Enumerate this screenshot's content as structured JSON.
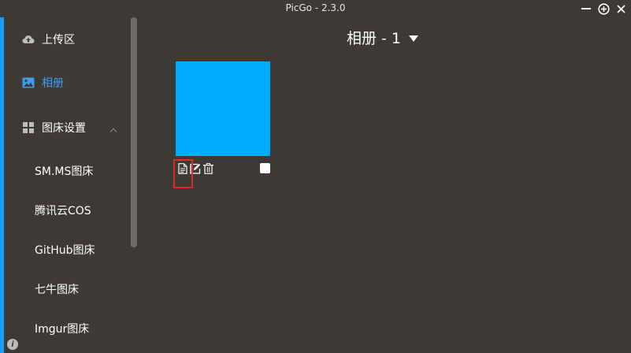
{
  "window": {
    "title": "PicGo - 2.3.0"
  },
  "sidebar": {
    "items": [
      {
        "label": "上传区",
        "icon": "cloud-upload-icon",
        "active": false
      },
      {
        "label": "相册",
        "icon": "image-icon",
        "active": true
      },
      {
        "label": "图床设置",
        "icon": "grid-icon",
        "active": false,
        "expanded": true
      }
    ],
    "sub_items": [
      {
        "label": "SM.MS图床"
      },
      {
        "label": "腾讯云COS"
      },
      {
        "label": "GitHub图床"
      },
      {
        "label": "七牛图床"
      },
      {
        "label": "Imgur图床"
      }
    ]
  },
  "album": {
    "header": "相册 - 1",
    "images": [
      {
        "color": "#00acff",
        "selected": false
      }
    ],
    "tools": [
      "copy-link-icon",
      "edit-icon",
      "delete-icon"
    ]
  },
  "colors": {
    "background": "#3d3a36",
    "accent": "#1a9bff",
    "active_text": "#3d9cf0",
    "highlight": "#e0292b"
  }
}
